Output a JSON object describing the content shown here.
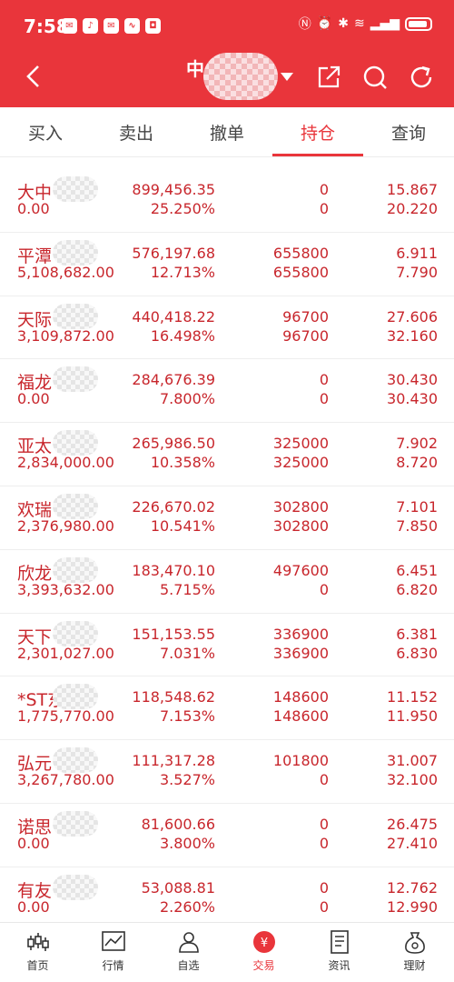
{
  "status_bar": {
    "time": "7:58"
  },
  "header": {
    "account_title": "中"
  },
  "tabs": [
    {
      "label": "买入"
    },
    {
      "label": "卖出"
    },
    {
      "label": "撤单"
    },
    {
      "label": "持仓"
    },
    {
      "label": "查询"
    }
  ],
  "active_tab": "持仓",
  "holdings": [
    {
      "name": "大中",
      "cost": "0.00",
      "market_value": "899,456.35",
      "ratio": "25.250%",
      "shares": "0",
      "available": "0",
      "current_price": "15.867",
      "cost_price": "20.220"
    },
    {
      "name": "平潭",
      "cost": "5,108,682.00",
      "market_value": "576,197.68",
      "ratio": "12.713%",
      "shares": "655800",
      "available": "655800",
      "current_price": "6.911",
      "cost_price": "7.790"
    },
    {
      "name": "天际",
      "cost": "3,109,872.00",
      "market_value": "440,418.22",
      "ratio": "16.498%",
      "shares": "96700",
      "available": "96700",
      "current_price": "27.606",
      "cost_price": "32.160"
    },
    {
      "name": "福龙",
      "cost": "0.00",
      "market_value": "284,676.39",
      "ratio": "7.800%",
      "shares": "0",
      "available": "0",
      "current_price": "30.430",
      "cost_price": "30.430"
    },
    {
      "name": "亚太",
      "cost": "2,834,000.00",
      "market_value": "265,986.50",
      "ratio": "10.358%",
      "shares": "325000",
      "available": "325000",
      "current_price": "7.902",
      "cost_price": "8.720"
    },
    {
      "name": "欢瑞",
      "cost": "2,376,980.00",
      "market_value": "226,670.02",
      "ratio": "10.541%",
      "shares": "302800",
      "available": "302800",
      "current_price": "7.101",
      "cost_price": "7.850"
    },
    {
      "name": "欣龙",
      "cost": "3,393,632.00",
      "market_value": "183,470.10",
      "ratio": "5.715%",
      "shares": "497600",
      "available": "0",
      "current_price": "6.451",
      "cost_price": "6.820"
    },
    {
      "name": "天下",
      "cost": "2,301,027.00",
      "market_value": "151,153.55",
      "ratio": "7.031%",
      "shares": "336900",
      "available": "336900",
      "current_price": "6.381",
      "cost_price": "6.830"
    },
    {
      "name": "*ST东",
      "cost": "1,775,770.00",
      "market_value": "118,548.62",
      "ratio": "7.153%",
      "shares": "148600",
      "available": "148600",
      "current_price": "11.152",
      "cost_price": "11.950"
    },
    {
      "name": "弘元",
      "cost": "3,267,780.00",
      "market_value": "111,317.28",
      "ratio": "3.527%",
      "shares": "101800",
      "available": "0",
      "current_price": "31.007",
      "cost_price": "32.100"
    },
    {
      "name": "诺思",
      "cost": "0.00",
      "market_value": "81,600.66",
      "ratio": "3.800%",
      "shares": "0",
      "available": "0",
      "current_price": "26.475",
      "cost_price": "27.410"
    },
    {
      "name": "有友",
      "cost": "0.00",
      "market_value": "53,088.81",
      "ratio": "2.260%",
      "shares": "0",
      "available": "0",
      "current_price": "12.762",
      "cost_price": "12.990"
    }
  ],
  "bottom_nav": [
    {
      "label": "首页",
      "icon": "candlestick-icon"
    },
    {
      "label": "行情",
      "icon": "chart-line-icon"
    },
    {
      "label": "自选",
      "icon": "person-icon"
    },
    {
      "label": "交易",
      "icon": "yen-icon"
    },
    {
      "label": "资讯",
      "icon": "document-icon"
    },
    {
      "label": "理财",
      "icon": "money-bag-icon"
    }
  ],
  "colors": {
    "brand": "#e9353b",
    "value_text": "#c8262c"
  }
}
